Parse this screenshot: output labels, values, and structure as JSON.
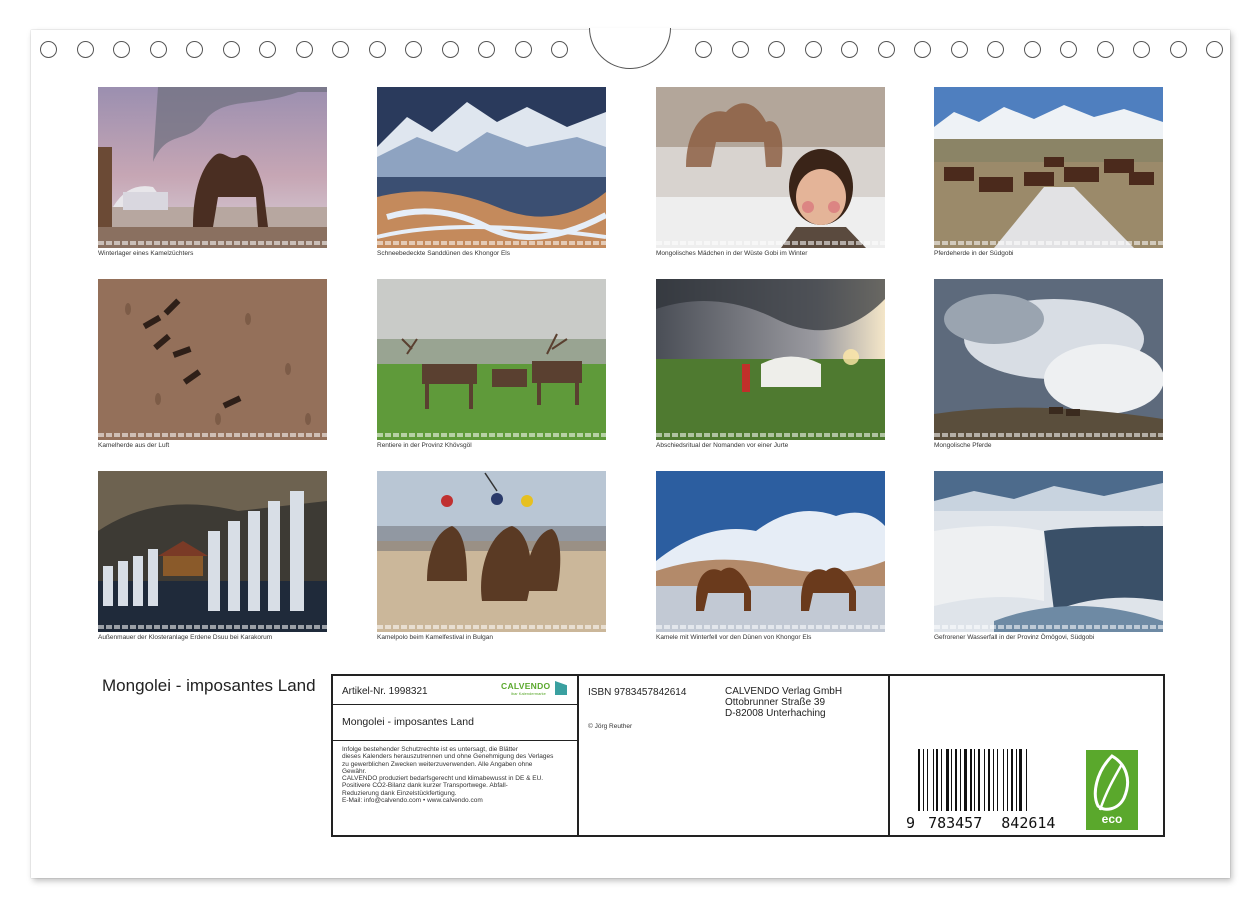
{
  "calendar": {
    "title": "Mongolei - imposantes Land",
    "photos": [
      {
        "caption": "Winterlager eines Kamelzüchters"
      },
      {
        "caption": "Schneebedeckte Sanddünen des Khongor Els"
      },
      {
        "caption": "Mongolisches Mädchen in der Wüste Gobi im Winter"
      },
      {
        "caption": "Pferdeherde in der Südgobi"
      },
      {
        "caption": "Kamelherde aus der Luft"
      },
      {
        "caption": "Rentiere in der Provinz Khövsgöl"
      },
      {
        "caption": "Abschiedsritual der Nomanden vor einer Jurte"
      },
      {
        "caption": "Mongolische Pferde"
      },
      {
        "caption": "Außenmauer der Klosteranlage Erdene Dsuu bei Karakorum"
      },
      {
        "caption": "Kamelpolo beim Kamelfestival in Bulgan"
      },
      {
        "caption": "Kamele mit Winterfell vor den Dünen von Khongor Els"
      },
      {
        "caption": "Gefrorener Wasserfall in der Provinz Ömögovi, Südgobi"
      }
    ]
  },
  "imprint": {
    "article": "Artikel-Nr. 1998321",
    "brand": "CALVENDO",
    "brand_tagline": "lbar Kalendermarke",
    "product_title": "Mongolei - imposantes Land",
    "legal_lines": [
      "Infolge bestehender Schutzrechte ist es untersagt, die Blätter",
      "dieses Kalenders herauszutrennen und ohne Genehmigung des Verlages",
      "zu gewerblichen Zwecken weiterzuverwenden. Alle Angaben ohne",
      "Gewähr.",
      "CALVENDO produziert bedarfsgerecht und klimabewusst in DE & EU.",
      "Positivere CO2-Bilanz dank kurzer Transportwege. Abfall-",
      "Reduzierung dank Einzelstückfertigung.",
      "E-Mail: info@calvendo.com • www.calvendo.com"
    ],
    "isbn": "ISBN 9783457842614",
    "copyright": "© Jörg Reuther",
    "publisher_name": "CALVENDO Verlag GmbH",
    "publisher_street": "Ottobrunner Straße 39",
    "publisher_city": "D-82008 Unterhaching",
    "barcode_digits": [
      "9",
      "783457",
      "842614"
    ],
    "eco_label": "eco"
  },
  "colors": {
    "brand_green": "#5aa82c",
    "frame": "#222222"
  },
  "icons": [
    "binding-hole-icon",
    "hanger-cutout-icon",
    "calvendo-logo-icon",
    "eco-leaf-icon",
    "barcode-icon"
  ]
}
